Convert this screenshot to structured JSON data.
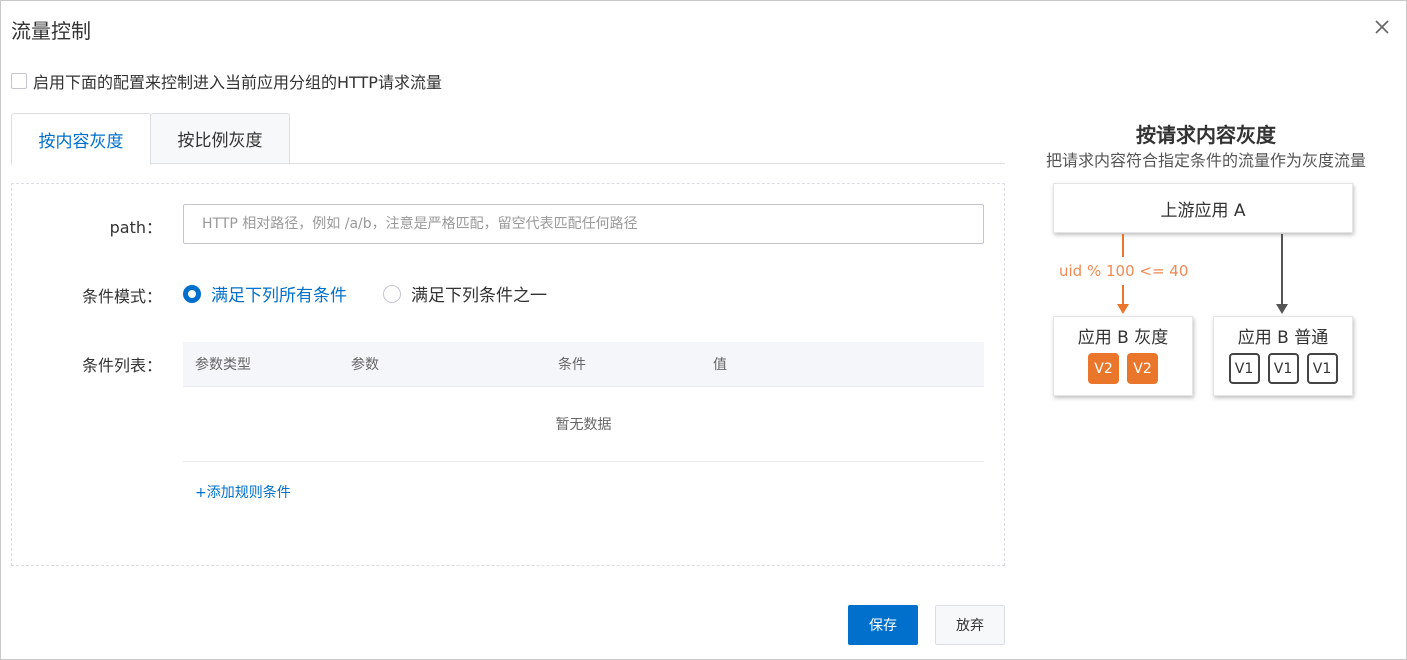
{
  "dialog": {
    "title": "流量控制",
    "close_icon": "close-icon"
  },
  "enable": {
    "label": "启用下面的配置来控制进入当前应用分组的HTTP请求流量",
    "checked": false
  },
  "tabs": [
    {
      "label": "按内容灰度",
      "active": true
    },
    {
      "label": "按比例灰度",
      "active": false
    }
  ],
  "form": {
    "path_label": "path：",
    "path_placeholder": "HTTP 相对路径，例如 /a/b，注意是严格匹配，留空代表匹配任何路径",
    "path_value": "",
    "mode_label": "条件模式：",
    "mode_options": [
      {
        "label": "满足下列所有条件",
        "checked": true
      },
      {
        "label": "满足下列条件之一",
        "checked": false
      }
    ],
    "list_label": "条件列表：",
    "table": {
      "columns": [
        "参数类型",
        "参数",
        "条件",
        "值"
      ],
      "empty_text": "暂无数据"
    },
    "add_rule": "+添加规则条件"
  },
  "actions": {
    "save": "保存",
    "cancel": "放弃"
  },
  "diagram": {
    "title": "按请求内容灰度",
    "subtitle": "把请求内容符合指定条件的流量作为灰度流量",
    "upstream": "上游应用 A",
    "rule": "uid % 100 <= 40",
    "gray_box": {
      "label": "应用 B 灰度",
      "chips": [
        "V2",
        "V2"
      ]
    },
    "normal_box": {
      "label": "应用 B 普通",
      "chips": [
        "V1",
        "V1",
        "V1"
      ]
    },
    "colors": {
      "gray_arrow": "#e9762b",
      "normal_arrow": "#555555",
      "accent": "#0070cc"
    }
  }
}
